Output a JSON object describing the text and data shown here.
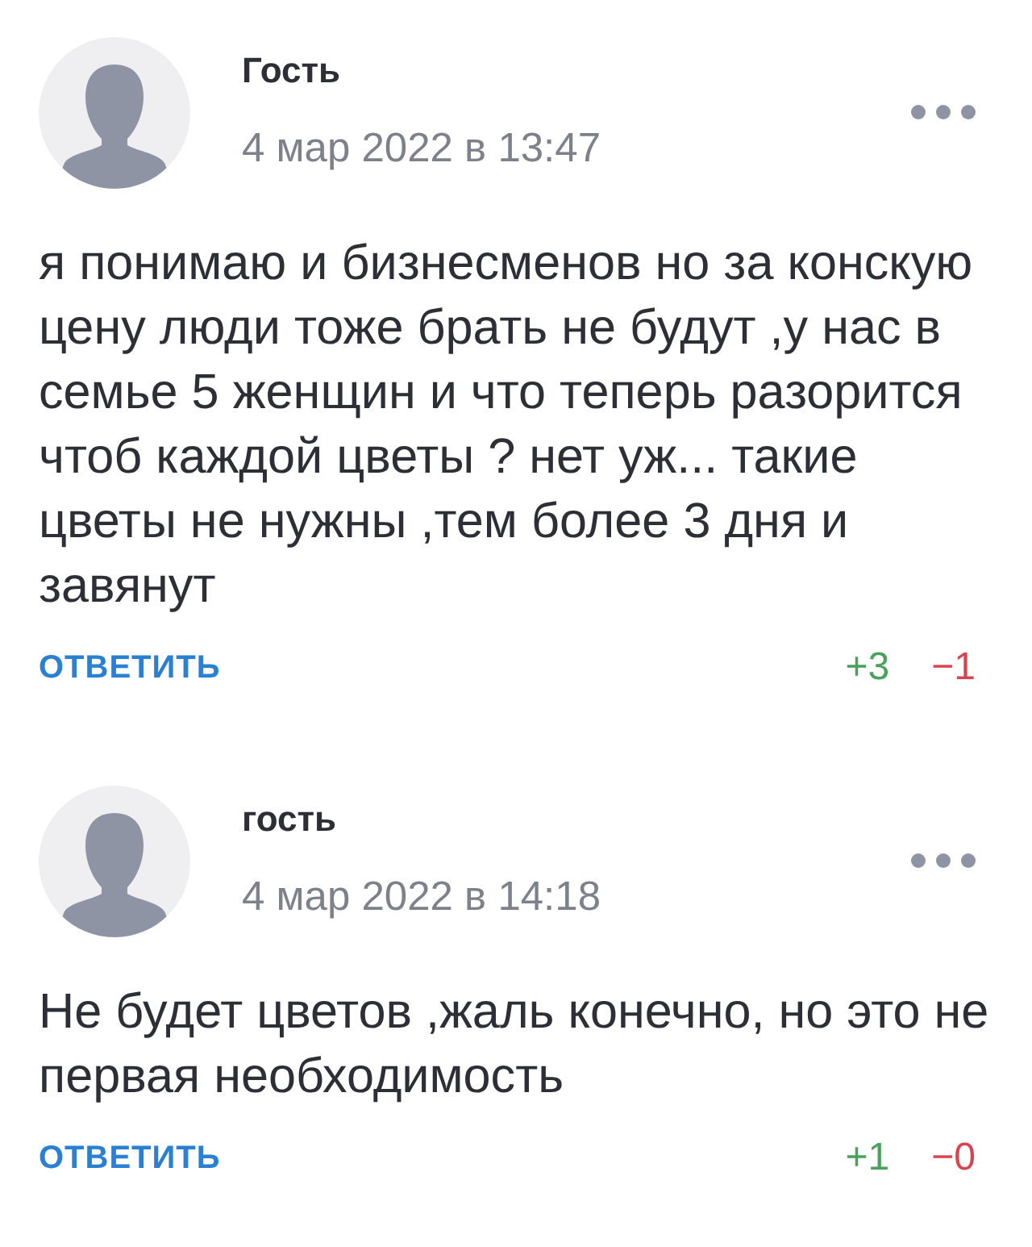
{
  "comments": [
    {
      "author": "Гость",
      "date": "4 мар 2022 в 13:47",
      "text": "я понимаю и бизнесменов но за конскую цену люди тоже брать не будут ,у нас в семье 5 женщин и что теперь разорится чтоб каждой цветы ? нет уж... такие цветы не нужны ,тем более 3 дня и завянут",
      "reply": "ОТВЕТИТЬ",
      "upvotes": "+3",
      "downvotes": "−1"
    },
    {
      "author": "гость",
      "date": "4 мар 2022 в 14:18",
      "text": "Не будет цветов ,жаль конечно, но это не первая необходимость",
      "reply": "ОТВЕТИТЬ",
      "upvotes": "+1",
      "downvotes": "−0"
    }
  ]
}
